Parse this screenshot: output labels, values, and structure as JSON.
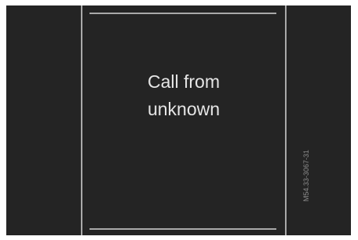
{
  "call_screen": {
    "message_line1": "Call from",
    "message_line2": "unknown"
  },
  "figure": {
    "ref_code": "M54.33-3067-31"
  },
  "colors": {
    "screen_background": "#242424",
    "divider": "#a9a9a9",
    "text": "#e6e6e6"
  }
}
